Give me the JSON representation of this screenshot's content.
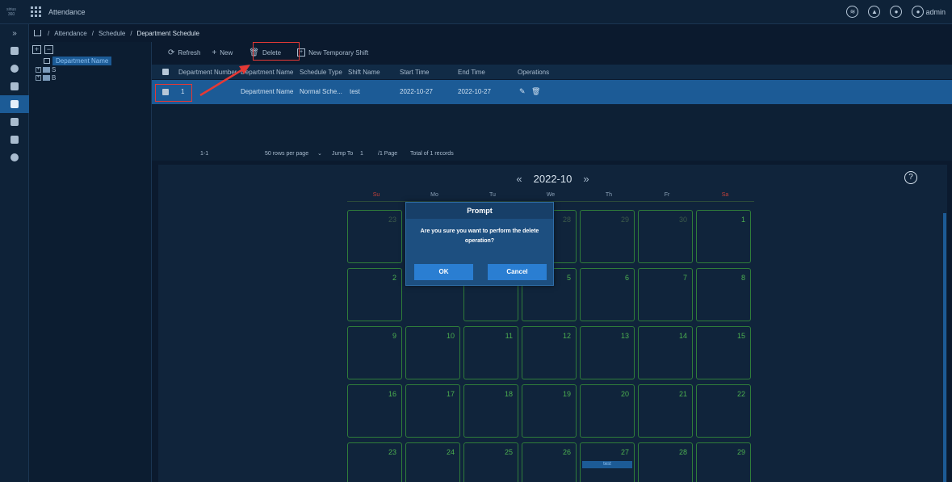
{
  "app": {
    "logo_top": "sirius",
    "logo_bottom": "360",
    "title": "Attendance",
    "user": "admin"
  },
  "breadcrumb": [
    "Attendance",
    "Schedule",
    "Department Schedule"
  ],
  "tree": {
    "root": "Department Name",
    "nodes": [
      "S",
      "B"
    ]
  },
  "toolbar": {
    "refresh": "Refresh",
    "new": "New",
    "delete": "Delete",
    "new_temp_shift": "New Temporary Shift"
  },
  "table": {
    "headers": [
      "Department Number",
      "Department Name",
      "Schedule Type",
      "Shift Name",
      "Start Time",
      "End Time",
      "Operations"
    ],
    "rows": [
      {
        "number": "1",
        "name": "Department Name",
        "type": "Normal Sche...",
        "shift": "test",
        "start": "2022-10-27",
        "end": "2022-10-27"
      }
    ]
  },
  "pager": {
    "range": "1-1",
    "rows_per_page": "50 rows per page",
    "jump_to": "Jump To",
    "page_value": "1",
    "page_total": "/1 Page",
    "total": "Total of 1 records"
  },
  "calendar": {
    "month": "2022-10",
    "weekdays": [
      "Su",
      "Mo",
      "Tu",
      "We",
      "Th",
      "Fr",
      "Sa"
    ],
    "weeks": [
      [
        "",
        "23",
        "",
        "28",
        "29",
        "30",
        "1"
      ],
      [
        "",
        "2",
        "",
        "",
        "5",
        "6",
        "7",
        "8"
      ],
      [
        "9",
        "10",
        "11",
        "12",
        "13",
        "14",
        "15"
      ],
      [
        "16",
        "17",
        "18",
        "19",
        "20",
        "21",
        "22"
      ],
      [
        "23",
        "24",
        "25",
        "26",
        "27",
        "28",
        "29"
      ]
    ],
    "event_label": "test"
  },
  "modal": {
    "title": "Prompt",
    "message": "Are you sure you want to perform the delete operation?",
    "ok": "OK",
    "cancel": "Cancel"
  },
  "colors": {
    "accent": "#1c5b96",
    "calendar_green": "#4caf50",
    "annotation_red": "#e53935"
  }
}
